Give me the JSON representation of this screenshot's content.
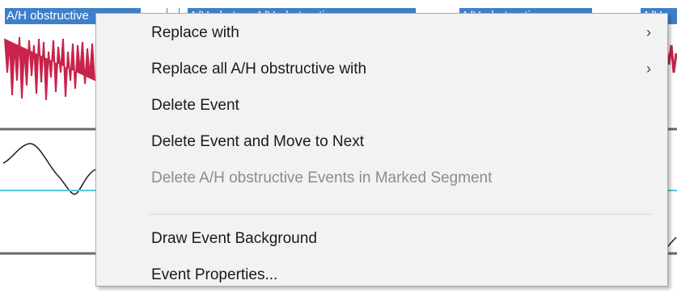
{
  "event_tags": [
    {
      "label": "A/H obstructive"
    },
    {
      "label": ""
    },
    {
      "label": "A/H obstruc A/H obstructive"
    },
    {
      "label": "A/H obstructive"
    },
    {
      "label": "A/H"
    }
  ],
  "context_menu": {
    "items": [
      {
        "label": "Replace with",
        "has_submenu": true,
        "enabled": true
      },
      {
        "label": "Replace all A/H obstructive with",
        "has_submenu": true,
        "enabled": true
      },
      {
        "label": "Delete Event",
        "has_submenu": false,
        "enabled": true
      },
      {
        "label": "Delete Event and Move to Next",
        "has_submenu": false,
        "enabled": true
      },
      {
        "label": "Delete A/H obstructive Events in Marked Segment",
        "has_submenu": false,
        "enabled": false
      },
      {
        "label": "Draw Event Background",
        "has_submenu": false,
        "enabled": true
      },
      {
        "label": "Event Properties...",
        "has_submenu": false,
        "enabled": true
      }
    ],
    "submenu_arrow": "›"
  },
  "colors": {
    "event_tag": "#3f7fca",
    "red_trace": "#c8234b",
    "cyan_line": "#55c8d8",
    "separator_line": "#6e6a62"
  }
}
